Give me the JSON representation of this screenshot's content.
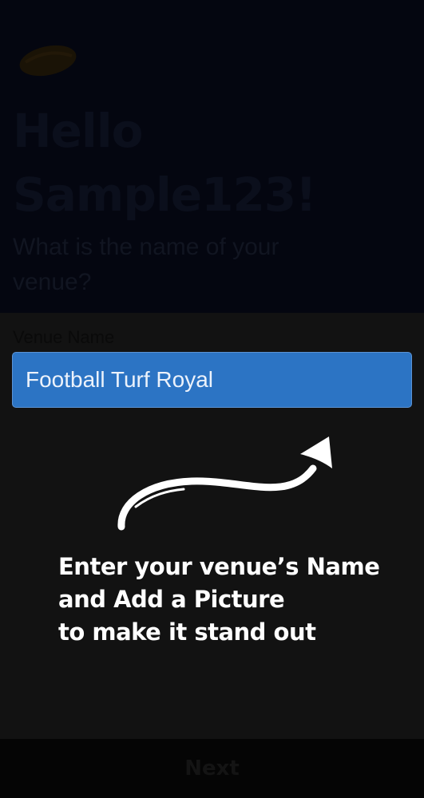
{
  "header": {
    "logo_icon": "football-logo-icon",
    "greeting": "Hello Sample123!",
    "question": "What is the name of your venue?"
  },
  "form": {
    "venue_label": "Venue Name",
    "venue_value": "Football Turf Royal"
  },
  "coachmark": {
    "arrow_icon": "curved-arrow-icon",
    "lines": [
      "Enter your venue’s Name",
      "and Add a Picture",
      "to make it stand out"
    ]
  },
  "footer": {
    "next_label": "Next"
  },
  "colors": {
    "input_background": "#2c74c4",
    "overlay_dark": "#121212",
    "header_background": "#040610",
    "tip_text": "#ffffff"
  }
}
